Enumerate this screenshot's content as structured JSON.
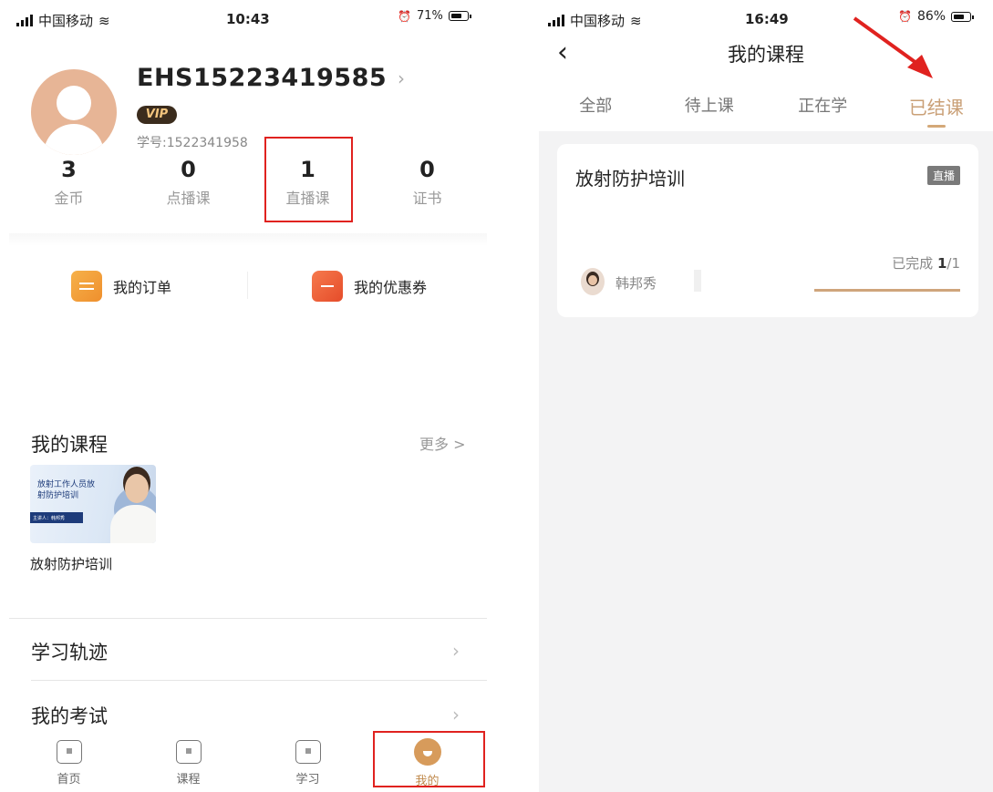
{
  "left": {
    "status": {
      "carrier": "中国移动",
      "time": "10:43",
      "battery": "71%"
    },
    "profile": {
      "username": "EHS15223419585",
      "vip": "VIP",
      "student_id": "学号:1522341958"
    },
    "stats": [
      {
        "value": "3",
        "label": "金币"
      },
      {
        "value": "0",
        "label": "点播课"
      },
      {
        "value": "1",
        "label": "直播课"
      },
      {
        "value": "0",
        "label": "证书"
      }
    ],
    "quick": {
      "orders": "我的订单",
      "coupons": "我的优惠券"
    },
    "courses": {
      "title": "我的课程",
      "more": "更多 >",
      "thumb_text": "放射工作人员放射防护培训",
      "thumb_tag": "主讲人：韩邦秀",
      "item": "放射防护培训"
    },
    "list": [
      {
        "label": "学习轨迹"
      },
      {
        "label": "我的考试"
      }
    ],
    "tabbar": [
      {
        "label": "首页",
        "icon": "home-icon"
      },
      {
        "label": "课程",
        "icon": "play-icon"
      },
      {
        "label": "学习",
        "icon": "bookmark-icon"
      },
      {
        "label": "我的",
        "icon": "profile-icon"
      }
    ]
  },
  "right": {
    "status": {
      "carrier": "中国移动",
      "time": "16:49",
      "battery": "86%"
    },
    "title": "我的课程",
    "tabs": [
      "全部",
      "待上课",
      "正在学",
      "已结课"
    ],
    "card": {
      "title": "放射防护培训",
      "tag": "直播",
      "teacher": "韩邦秀",
      "done_label": "已完成",
      "done_value": "1",
      "done_total": "/1",
      "progress": 1.0
    }
  },
  "colors": {
    "accent": "#caa077",
    "highlight": "#e0221f",
    "vip_bg": "#3b2c1d"
  }
}
